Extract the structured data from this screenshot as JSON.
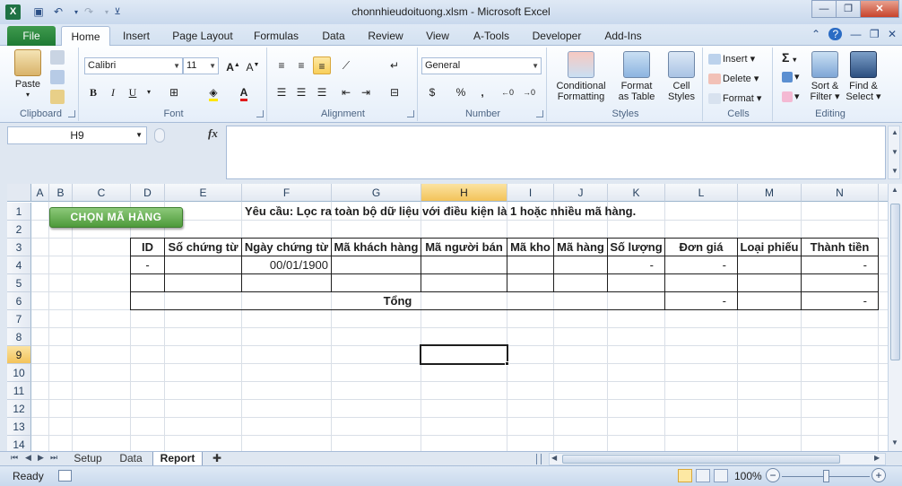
{
  "window": {
    "title": "chonnhieudoituong.xlsm - Microsoft Excel",
    "app_icon": "X"
  },
  "ribbon_tabs": [
    {
      "label": "File"
    },
    {
      "label": "Home"
    },
    {
      "label": "Insert"
    },
    {
      "label": "Page Layout"
    },
    {
      "label": "Formulas"
    },
    {
      "label": "Data"
    },
    {
      "label": "Review"
    },
    {
      "label": "View"
    },
    {
      "label": "A-Tools"
    },
    {
      "label": "Developer"
    },
    {
      "label": "Add-Ins"
    }
  ],
  "ribbon": {
    "clipboard": {
      "label": "Clipboard",
      "paste": "Paste"
    },
    "font": {
      "label": "Font",
      "name": "Calibri",
      "size": "11",
      "bold": "B",
      "italic": "I",
      "underline": "U"
    },
    "alignment": {
      "label": "Alignment"
    },
    "number": {
      "label": "Number",
      "format": "General",
      "currency": "$",
      "percent": "%",
      "comma": ","
    },
    "styles": {
      "label": "Styles",
      "conditional": [
        "Conditional",
        "Formatting"
      ],
      "format_table": [
        "Format",
        "as Table"
      ],
      "cell_styles": [
        "Cell",
        "Styles"
      ]
    },
    "cells": {
      "label": "Cells",
      "insert": "Insert",
      "delete": "Delete",
      "format": "Format"
    },
    "editing": {
      "label": "Editing",
      "sort": [
        "Sort &",
        "Filter"
      ],
      "find": [
        "Find &",
        "Select"
      ],
      "sum": "Σ"
    }
  },
  "formula_bar": {
    "name_box": "H9",
    "fx": "fx",
    "formula": ""
  },
  "columns": [
    {
      "label": "A"
    },
    {
      "label": "B"
    },
    {
      "label": "C"
    },
    {
      "label": "D"
    },
    {
      "label": "E"
    },
    {
      "label": "F"
    },
    {
      "label": "G"
    },
    {
      "label": "H"
    },
    {
      "label": "I"
    },
    {
      "label": "J"
    },
    {
      "label": "K"
    },
    {
      "label": "L"
    },
    {
      "label": "M"
    },
    {
      "label": "N"
    }
  ],
  "rows": [
    "1",
    "2",
    "3",
    "4",
    "5",
    "6",
    "7",
    "8",
    "9",
    "10",
    "11",
    "12",
    "13",
    "14"
  ],
  "selected_cell": "H9",
  "sheet": {
    "macro_button": "CHỌN   MÃ HÀNG",
    "requirement": "Yêu cầu: Lọc ra toàn bộ dữ liệu với điều kiện là 1 hoặc nhiều mã hàng.",
    "table_headers": [
      "ID",
      "Số chứng từ",
      "Ngày chứng từ",
      "Mã khách hàng",
      "Mã người bán",
      "Mã kho",
      "Mã hàng",
      "Số lượng",
      "Đơn giá",
      "Loại phiếu",
      "Thành tiền"
    ],
    "row4": {
      "id": "-",
      "date": "00/01/1900",
      "qty": "-",
      "price": "-",
      "amount": "-"
    },
    "total_label": "Tổng",
    "total_price": "-",
    "total_amount": "-"
  },
  "sheet_tabs": [
    {
      "label": "Setup"
    },
    {
      "label": "Data"
    },
    {
      "label": "Report"
    }
  ],
  "active_sheet": "Report",
  "status": {
    "ready": "Ready",
    "zoom": "100%"
  }
}
